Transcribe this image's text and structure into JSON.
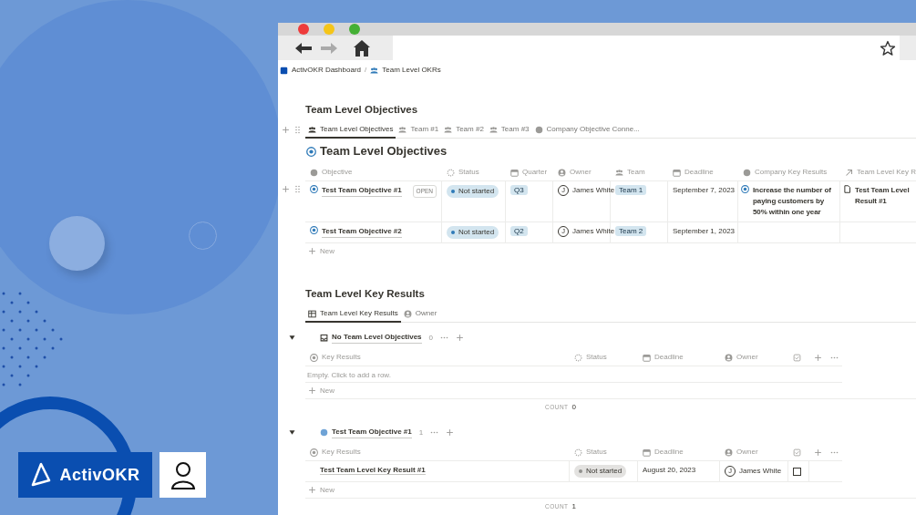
{
  "brand": {
    "name": "ActivOKR"
  },
  "breadcrumb": {
    "separator": "/",
    "items": [
      {
        "label": "ActivOKR Dashboard"
      },
      {
        "label": "Team Level OKRs"
      }
    ]
  },
  "objectives": {
    "title": "Team Level Objectives",
    "tabs": [
      {
        "label": "Team Level Objectives",
        "selected": true
      },
      {
        "label": "Team #1",
        "selected": false
      },
      {
        "label": "Team #2",
        "selected": false
      },
      {
        "label": "Team #3",
        "selected": false
      },
      {
        "label": "Company Objective Conne...",
        "selected": false
      }
    ],
    "heading": "Team Level Objectives",
    "columns": [
      "Objective",
      "Status",
      "Quarter",
      "Owner",
      "Team",
      "Deadline",
      "Company Key Results",
      "Team Level Key R"
    ],
    "rows": [
      {
        "objective": "Test Team Objective #1",
        "open_button": "OPEN",
        "status": "Not started",
        "quarter": "Q3",
        "owner_initial": "J",
        "owner": "James White",
        "team": "Team 1",
        "deadline": "September 7, 2023",
        "company_key_result": "Increase the number of paying customers by 50% within one year",
        "team_key_result": "Test Team Level Result #1"
      },
      {
        "objective": "Test Team Objective #2",
        "status": "Not started",
        "quarter": "Q2",
        "owner_initial": "J",
        "owner": "James White",
        "team": "Team 2",
        "deadline": "September 1, 2023"
      }
    ],
    "new_label": "New"
  },
  "key_results": {
    "title": "Team Level Key Results",
    "tabs": [
      {
        "label": "Team Level Key Results",
        "selected": true
      },
      {
        "label": "Owner",
        "selected": false
      }
    ],
    "groups": [
      {
        "kind": "empty",
        "title": "No Team Level Objectives",
        "count": "0",
        "expanded": true,
        "columns": [
          "Key Results",
          "Status",
          "Deadline",
          "Owner"
        ],
        "empty_text": "Empty. Click to add a row.",
        "new_label": "New",
        "count_label": "COUNT",
        "count_value": "0"
      },
      {
        "kind": "objective",
        "title": "Test Team Objective #1",
        "count": "1",
        "expanded": true,
        "columns": [
          "Key Results",
          "Status",
          "Deadline",
          "Owner"
        ],
        "rows": [
          {
            "key_result": "Test Team Level Key Result #1",
            "status": "Not started",
            "deadline": "August 20, 2023",
            "owner_initial": "J",
            "owner": "James White",
            "done": false
          }
        ],
        "new_label": "New",
        "count_label": "COUNT",
        "count_value": "1"
      }
    ]
  }
}
